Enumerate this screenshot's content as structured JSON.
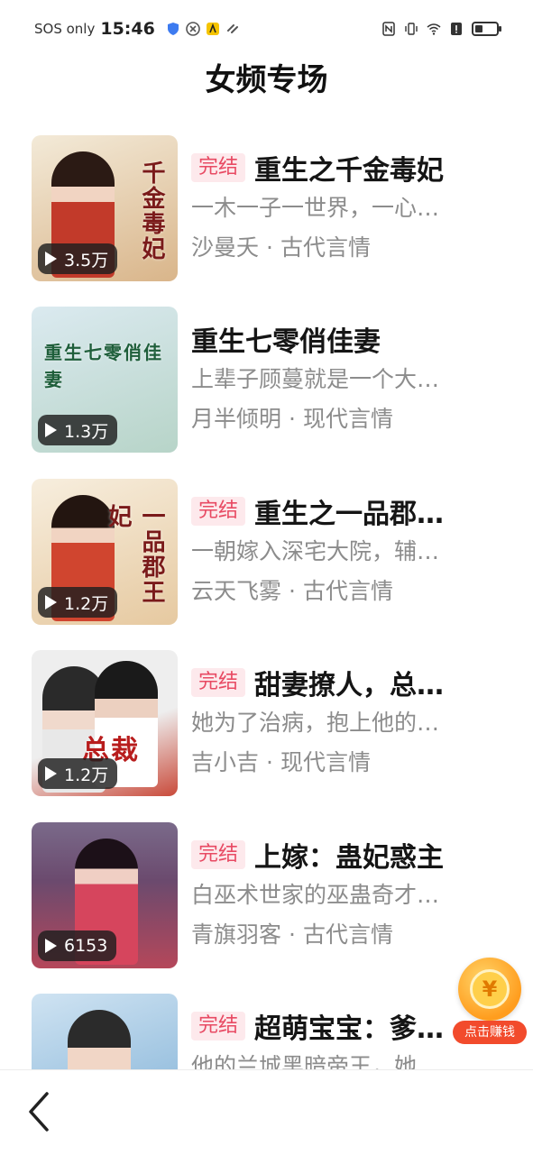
{
  "status_bar": {
    "left_text": "SOS only",
    "time": "15:46"
  },
  "header": {
    "title": "女频专场"
  },
  "books": [
    {
      "tag": "完结",
      "title": "重生之千金毒妃",
      "desc": "一木一子一世界，一心…",
      "author": "沙曼夭",
      "category": "古代言情",
      "plays": "3.5万",
      "cover_text": "千金毒妃",
      "cover_colors": [
        "#f3ead8",
        "#d9b58a"
      ]
    },
    {
      "tag": "",
      "title": "重生七零俏佳妻",
      "desc": "上辈子顾蔓就是一个大…",
      "author": "月半倾明",
      "category": "现代言情",
      "plays": "1.3万",
      "cover_text": "重生七零俏佳妻",
      "cover_colors": [
        "#dbeaf0",
        "#b7d4c8"
      ]
    },
    {
      "tag": "完结",
      "title": "重生之一品郡…",
      "desc": "一朝嫁入深宅大院，辅…",
      "author": "云天飞雾",
      "category": "古代言情",
      "plays": "1.2万",
      "cover_text": "一品郡王妃",
      "cover_colors": [
        "#f7eede",
        "#e6c9a0"
      ]
    },
    {
      "tag": "完结",
      "title": "甜妻撩人，总…",
      "desc": "她为了治病，抱上他的…",
      "author": "吉小吉",
      "category": "现代言情",
      "plays": "1.2万",
      "cover_text": "总裁",
      "cover_colors": [
        "#eeeeee",
        "#c94a3a"
      ]
    },
    {
      "tag": "完结",
      "title": "上嫁：蛊妃惑主",
      "desc": "白巫术世家的巫蛊奇才…",
      "author": "青旗羽客",
      "category": "古代言情",
      "plays": "6153",
      "cover_text": "",
      "cover_colors": [
        "#6b4a6e",
        "#b5475a"
      ]
    },
    {
      "tag": "完结",
      "title": "超萌宝宝：爹…",
      "desc": "他的兰城黑暗帝王，她…",
      "author": "",
      "category": "",
      "plays": "",
      "cover_text": "",
      "cover_colors": [
        "#cfe3f2",
        "#7fb0d6"
      ]
    }
  ],
  "earn": {
    "coin_symbol": "¥",
    "label": "点击赚钱"
  },
  "icons": {
    "back": "chevron-left-icon",
    "play": "play-icon"
  }
}
